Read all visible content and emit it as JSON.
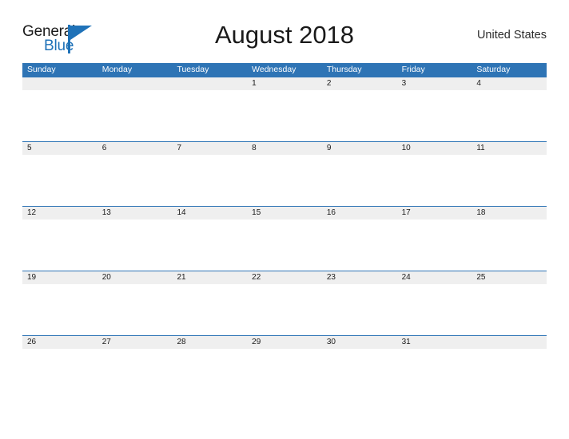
{
  "logo": {
    "word_top": "General",
    "word_bottom": "Blue",
    "mark": "triangle-flag-mark",
    "brand_color": "#1f72b8"
  },
  "header": {
    "title": "August 2018",
    "country": "United States"
  },
  "calendar": {
    "header_color": "#2E74B5",
    "band_color": "#EFEFEF",
    "weekdays": [
      "Sunday",
      "Monday",
      "Tuesday",
      "Wednesday",
      "Thursday",
      "Friday",
      "Saturday"
    ],
    "weeks": [
      [
        "",
        "",
        "",
        "1",
        "2",
        "3",
        "4"
      ],
      [
        "5",
        "6",
        "7",
        "8",
        "9",
        "10",
        "11"
      ],
      [
        "12",
        "13",
        "14",
        "15",
        "16",
        "17",
        "18"
      ],
      [
        "19",
        "20",
        "21",
        "22",
        "23",
        "24",
        "25"
      ],
      [
        "26",
        "27",
        "28",
        "29",
        "30",
        "31",
        ""
      ]
    ]
  }
}
